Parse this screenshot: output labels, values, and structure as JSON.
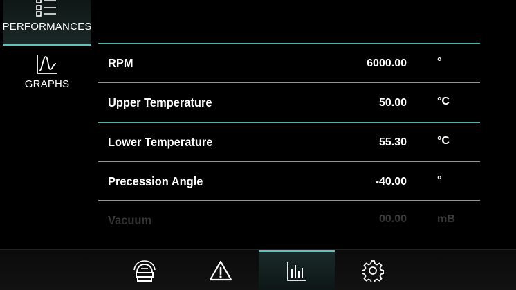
{
  "sidebar": {
    "tabs": [
      {
        "label": "PERFORMANCES",
        "icon": "list-icon",
        "active": true
      },
      {
        "label": "GRAPHS",
        "icon": "graph-icon",
        "active": false
      }
    ]
  },
  "table": {
    "rows": [
      {
        "name": "RPM",
        "value": "6000.00",
        "unit": "°"
      },
      {
        "name": "Upper Temperature",
        "value": "50.00",
        "unit": "°C"
      },
      {
        "name": "Lower Temperature",
        "value": "55.30",
        "unit": "°C"
      },
      {
        "name": "Precession Angle",
        "value": "-40.00",
        "unit": "°"
      },
      {
        "name": "Vacuum",
        "value": "00.00",
        "unit": "mB"
      }
    ]
  },
  "bottom_nav": {
    "items": [
      {
        "icon": "hood-icon",
        "active": false
      },
      {
        "icon": "warning-icon",
        "active": false
      },
      {
        "icon": "bar-chart-icon",
        "active": true
      },
      {
        "icon": "gear-icon",
        "active": false
      }
    ]
  },
  "colors": {
    "accent": "#5fc2bc",
    "background": "#000000",
    "text": "#ffffff"
  }
}
